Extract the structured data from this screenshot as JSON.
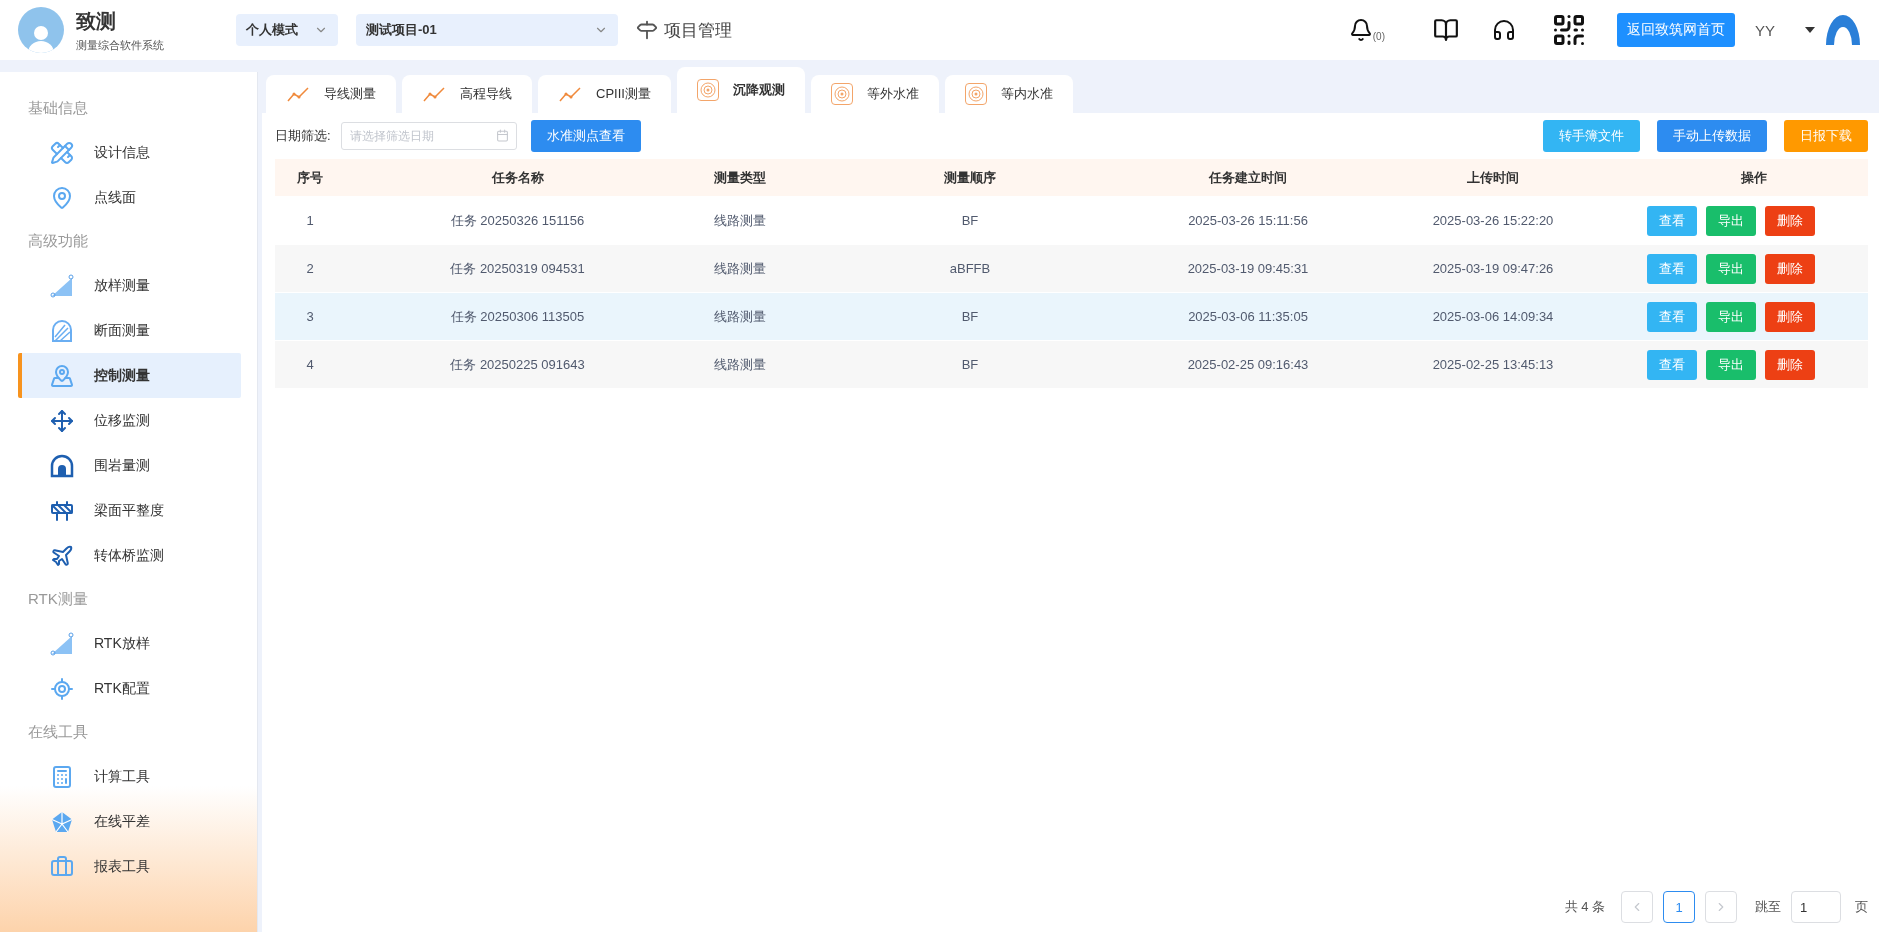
{
  "header": {
    "app_title": "致测",
    "app_subtitle": "测量综合软件系统",
    "mode_select": {
      "value": "个人模式"
    },
    "project_select": {
      "value": "测试项目-01"
    },
    "project_link": "项目管理",
    "notification_count": "(0)",
    "home_button": "返回致筑网首页",
    "user": "YY"
  },
  "sidebar": {
    "sections": [
      {
        "title": "基础信息",
        "items": [
          {
            "label": "设计信息",
            "selected": false
          },
          {
            "label": "点线面",
            "selected": false
          }
        ]
      },
      {
        "title": "高级功能",
        "items": [
          {
            "label": "放样测量",
            "selected": false
          },
          {
            "label": "断面测量",
            "selected": false
          },
          {
            "label": "控制测量",
            "selected": true
          },
          {
            "label": "位移监测",
            "selected": false
          },
          {
            "label": "围岩量测",
            "selected": false
          },
          {
            "label": "梁面平整度",
            "selected": false
          },
          {
            "label": "转体桥监测",
            "selected": false
          }
        ]
      },
      {
        "title": "RTK测量",
        "items": [
          {
            "label": "RTK放样",
            "selected": false
          },
          {
            "label": "RTK配置",
            "selected": false
          }
        ]
      },
      {
        "title": "在线工具",
        "items": [
          {
            "label": "计算工具",
            "selected": false
          },
          {
            "label": "在线平差",
            "selected": false
          },
          {
            "label": "报表工具",
            "selected": false
          }
        ]
      }
    ]
  },
  "tabs": [
    {
      "label": "导线测量",
      "selected": false,
      "kind": "line"
    },
    {
      "label": "高程导线",
      "selected": false,
      "kind": "line"
    },
    {
      "label": "CPIII测量",
      "selected": false,
      "kind": "line"
    },
    {
      "label": "沉降观测",
      "selected": true,
      "kind": "ring"
    },
    {
      "label": "等外水准",
      "selected": false,
      "kind": "ring"
    },
    {
      "label": "等内水准",
      "selected": false,
      "kind": "ring"
    }
  ],
  "toolbar": {
    "date_label": "日期筛选:",
    "date_field": {
      "placeholder": "请选择筛选日期"
    },
    "left_buttons": [
      {
        "label": "水准测点查看",
        "kind": "primary"
      }
    ],
    "right_buttons": [
      {
        "label": "转手簿文件",
        "kind": "info"
      },
      {
        "label": "手动上传数据",
        "kind": "primary"
      },
      {
        "label": "日报下载",
        "kind": "warning"
      }
    ]
  },
  "table": {
    "columns": [
      "序号",
      "任务名称",
      "测量类型",
      "测量顺序",
      "任务建立时间",
      "上传时间",
      "操作"
    ],
    "rows": [
      {
        "selected": false,
        "cells": [
          "1",
          "任务 20250326 151156",
          "线路测量",
          "BF",
          "2025-03-26 15:11:56",
          "2025-03-26 15:22:20"
        ],
        "actions": [
          {
            "label": "查看",
            "kind": "info"
          },
          {
            "label": "导出",
            "kind": "success"
          },
          {
            "label": "删除",
            "kind": "danger"
          }
        ]
      },
      {
        "selected": false,
        "cells": [
          "2",
          "任务 20250319 094531",
          "线路测量",
          "aBFFB",
          "2025-03-19 09:45:31",
          "2025-03-19 09:47:26"
        ],
        "actions": [
          {
            "label": "查看",
            "kind": "info"
          },
          {
            "label": "导出",
            "kind": "success"
          },
          {
            "label": "删除",
            "kind": "danger"
          }
        ]
      },
      {
        "selected": true,
        "cells": [
          "3",
          "任务 20250306 113505",
          "线路测量",
          "BF",
          "2025-03-06 11:35:05",
          "2025-03-06 14:09:34"
        ],
        "actions": [
          {
            "label": "查看",
            "kind": "info"
          },
          {
            "label": "导出",
            "kind": "success"
          },
          {
            "label": "删除",
            "kind": "danger"
          }
        ]
      },
      {
        "selected": false,
        "cells": [
          "4",
          "任务 20250225 091643",
          "线路测量",
          "BF",
          "2025-02-25 09:16:43",
          "2025-02-25 13:45:13"
        ],
        "actions": [
          {
            "label": "查看",
            "kind": "info"
          },
          {
            "label": "导出",
            "kind": "success"
          },
          {
            "label": "删除",
            "kind": "danger"
          }
        ]
      }
    ]
  },
  "pagination": {
    "total": "共 4 条",
    "pages": [
      {
        "label": "1",
        "selected": true
      }
    ],
    "jump_label": "跳至",
    "jump_value": "1",
    "page_suffix": "页"
  }
}
